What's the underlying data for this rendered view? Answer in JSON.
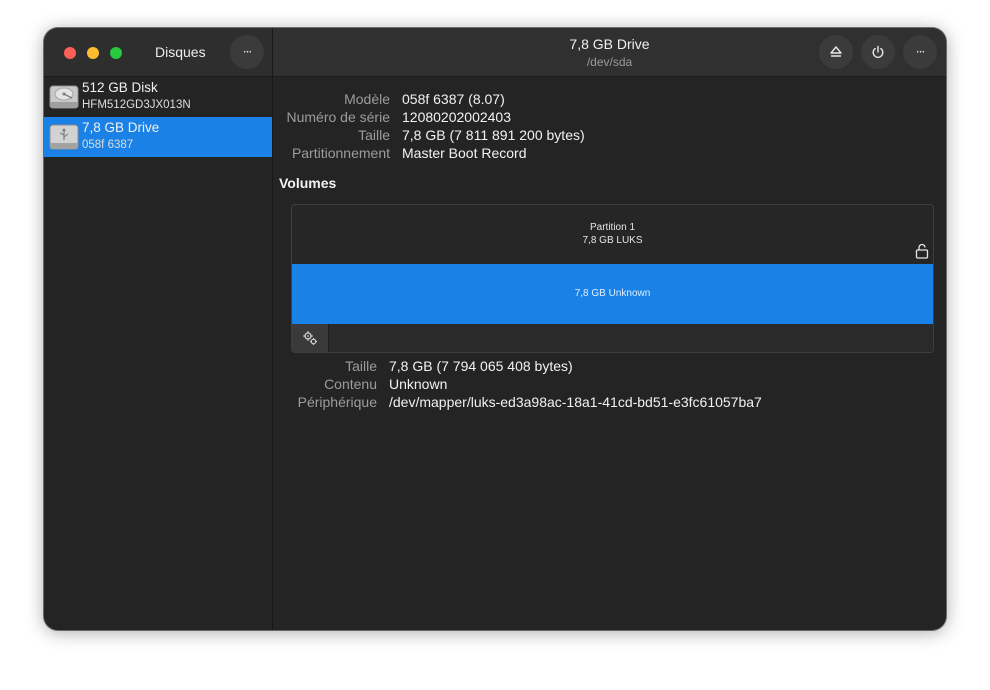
{
  "app": {
    "title": "Disques"
  },
  "header": {
    "title": "7,8 GB Drive",
    "subtitle": "/dev/sda",
    "menu_glyph": "···"
  },
  "sidebar": {
    "items": [
      {
        "name": "512 GB Disk",
        "sub": "HFM512GD3JX013N",
        "icon": "hard-disk-icon",
        "selected": false
      },
      {
        "name": "7,8 GB Drive",
        "sub": "058f 6387",
        "icon": "usb-drive-icon",
        "selected": true
      }
    ]
  },
  "drive_info": {
    "rows": [
      {
        "label": "Modèle",
        "value": "058f 6387 (8.07)"
      },
      {
        "label": "Numéro de série",
        "value": "12080202002403"
      },
      {
        "label": "Taille",
        "value": "7,8 GB (7 811 891 200 bytes)"
      },
      {
        "label": "Partitionnement",
        "value": "Master Boot Record"
      }
    ]
  },
  "volumes": {
    "title": "Volumes",
    "partition_name": "Partition 1",
    "partition_sub": "7,8 GB LUKS",
    "inner_label": "7,8 GB Unknown"
  },
  "volume_info": {
    "rows": [
      {
        "label": "Taille",
        "value": "7,8 GB (7 794 065 408 bytes)"
      },
      {
        "label": "Contenu",
        "value": "Unknown"
      },
      {
        "label": "Périphérique",
        "value": "/dev/mapper/luks-ed3a98ac-18a1-41cd-bd51-e3fc61057ba7"
      }
    ]
  },
  "colors": {
    "accent": "#1a82e7",
    "window_bg": "#242424",
    "close": "#ff5f57",
    "minimize": "#febc2e",
    "maximize": "#28c840"
  }
}
